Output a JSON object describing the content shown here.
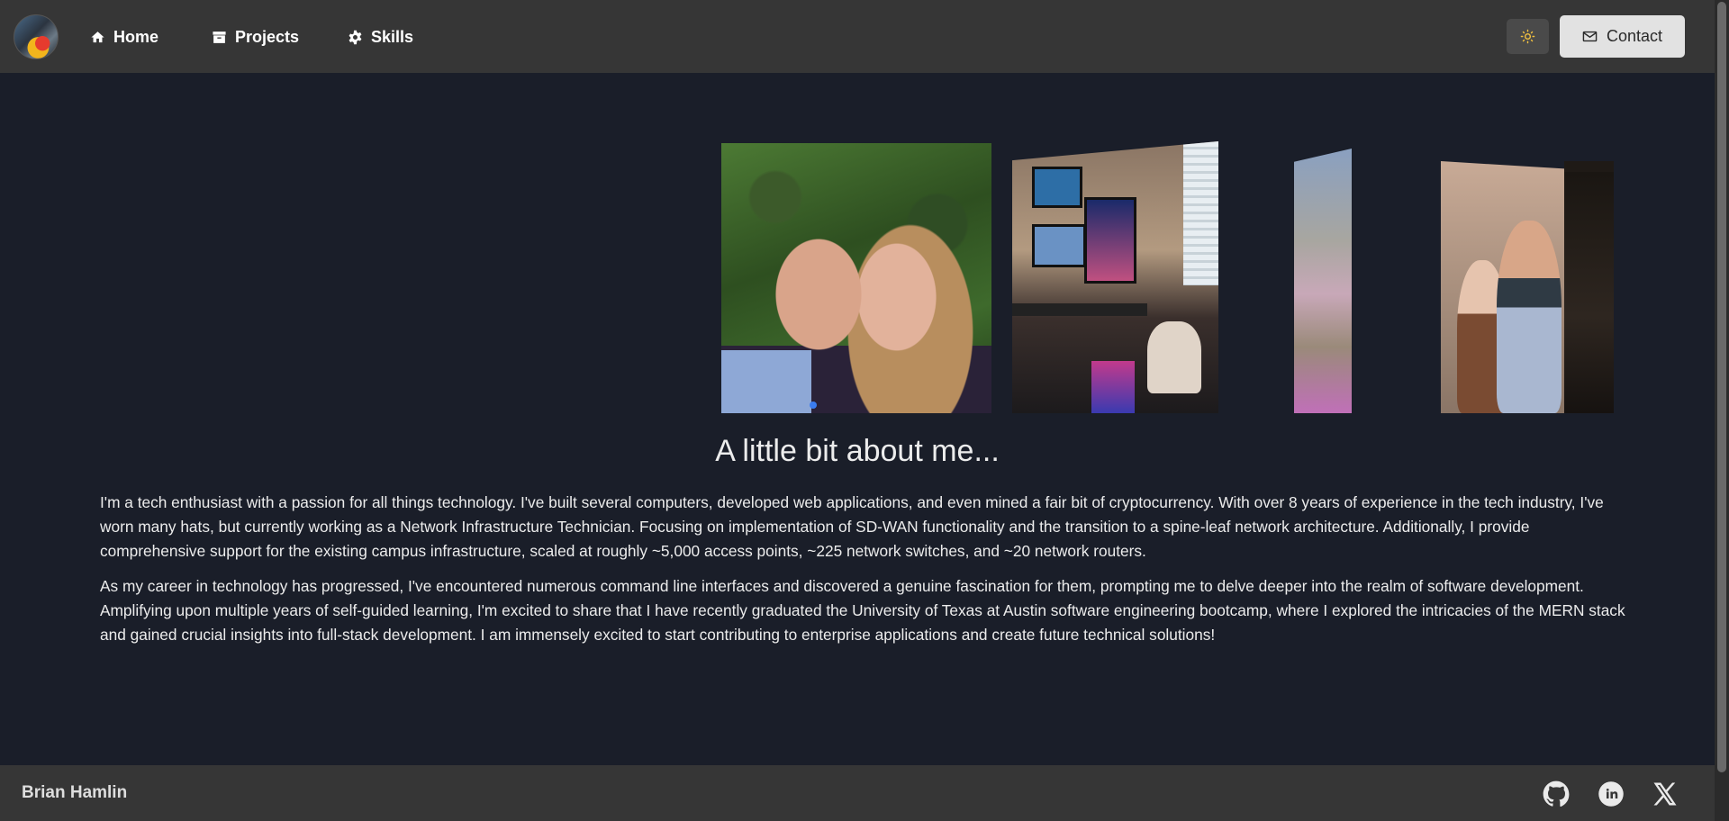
{
  "nav": {
    "home_label": "Home",
    "projects_label": "Projects",
    "skills_label": "Skills",
    "contact_label": "Contact"
  },
  "about": {
    "title": "A little bit about me...",
    "paragraphs": [
      "I'm a tech enthusiast with a passion for all things technology. I've built several computers, developed web applications, and even mined a fair bit of cryptocurrency. With over 8 years of experience in the tech industry, I've worn many hats, but currently working as a Network Infrastructure Technician. Focusing on implementation of SD-WAN functionality and the transition to a spine-leaf network architecture. Additionally, I provide comprehensive support for the existing campus infrastructure, scaled at roughly ~5,000 access points, ~225 network switches, and ~20 network routers.",
      "As my career in technology has progressed, I've encountered numerous command line interfaces and discovered a genuine fascination for them, prompting me to delve deeper into the realm of software development. Amplifying upon multiple years of self-guided learning, I'm excited to share that I have recently graduated the University of Texas at Austin software engineering bootcamp, where I explored the intricacies of the MERN stack and gained crucial insights into full-stack development. I am immensely excited to start contributing to enterprise applications and create future technical solutions!"
    ]
  },
  "footer": {
    "name": "Brian Hamlin"
  },
  "icons": {
    "home": "home-icon",
    "projects": "archive-icon",
    "skills": "gear-icon",
    "theme": "sun-icon",
    "contact": "mail-icon",
    "github": "github-icon",
    "linkedin": "linkedin-icon",
    "x": "x-logo-icon"
  },
  "colors": {
    "background": "#1a1e29",
    "navbar": "#363636",
    "footer": "#363636",
    "contact_button": "#e2e2e2",
    "carousel_indicator": "#3b7df0"
  }
}
